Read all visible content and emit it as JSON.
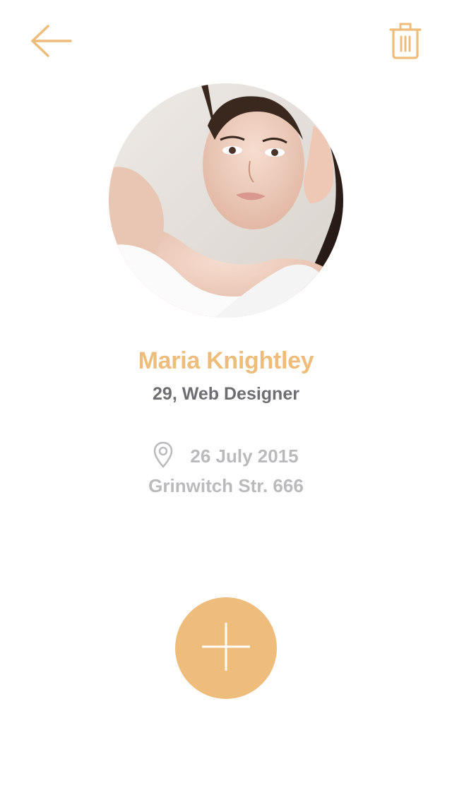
{
  "colors": {
    "accent": "#eebc7b",
    "subtitle": "#6d6e71",
    "muted": "#b9babc",
    "fab_icon": "#ffffff"
  },
  "header": {
    "back_icon": "arrow-left-icon",
    "delete_icon": "trash-icon"
  },
  "profile": {
    "avatar": "profile-photo",
    "name": "Maria Knightley",
    "subtitle": "29, Web Designer"
  },
  "info": {
    "location_icon": "location-pin-icon",
    "date": "26 July 2015",
    "address": "Grinwitch Str. 666"
  },
  "fab": {
    "icon": "plus-icon"
  }
}
